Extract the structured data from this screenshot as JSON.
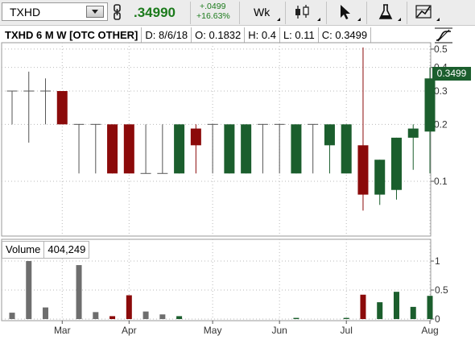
{
  "toolbar": {
    "symbol": "TXHD",
    "last_price": ".34990",
    "change_abs": "+.0499",
    "change_pct": "+16.63%",
    "period": "Wk",
    "icons": [
      "link-icon",
      "candlestick-style-icon",
      "cursor-icon",
      "studies-flask-icon",
      "drawing-tools-icon"
    ]
  },
  "info": {
    "title": "TXHD 6 M W [OTC OTHER]",
    "date": "D: 8/6/18",
    "open": "O: 0.1832",
    "high": "H: 0.4",
    "low": "L: 0.11",
    "close": "C: 0.3499"
  },
  "price_badge": "0.3499",
  "volume": {
    "label": "Volume",
    "value": "404,249"
  },
  "colors": {
    "up": "#1b5e2d",
    "down": "#8b0a0a",
    "neutral": "#555555",
    "volume_neutral": "#6e6e6e",
    "grid": "#b9b9b9",
    "price_green": "#1b7a1b"
  },
  "chart_data": {
    "type": "candlestick",
    "scale": "log",
    "price_axis": {
      "ticks": [
        "0.5",
        "0.4",
        "0.3",
        "0.2",
        "0.1"
      ],
      "tick_values": [
        0.5,
        0.4,
        0.3,
        0.2,
        0.1
      ]
    },
    "volume_axis": {
      "ticks": [
        "1",
        "0.5",
        "0"
      ],
      "tick_values": [
        1,
        0.5,
        0
      ],
      "unit": "M"
    },
    "month_labels": [
      "Mar",
      "Apr",
      "May",
      "Jun",
      "Jul",
      "Aug"
    ],
    "month_label_weeks": [
      3,
      7,
      12,
      16,
      20,
      25
    ],
    "candles": [
      {
        "o": 0.3,
        "h": 0.3,
        "l": 0.2,
        "c": 0.3,
        "v": 0.11
      },
      {
        "o": 0.3,
        "h": 0.38,
        "l": 0.16,
        "c": 0.3,
        "v": 1.0
      },
      {
        "o": 0.3,
        "h": 0.35,
        "l": 0.2,
        "c": 0.3,
        "v": 0.2
      },
      {
        "o": 0.3,
        "h": 0.3,
        "l": 0.2,
        "c": 0.2,
        "v": 0.0
      },
      {
        "o": 0.2,
        "h": 0.2,
        "l": 0.11,
        "c": 0.2,
        "v": 0.93
      },
      {
        "o": 0.2,
        "h": 0.2,
        "l": 0.11,
        "c": 0.2,
        "v": 0.12
      },
      {
        "o": 0.2,
        "h": 0.2,
        "l": 0.11,
        "c": 0.11,
        "v": 0.05
      },
      {
        "o": 0.2,
        "h": 0.2,
        "l": 0.11,
        "c": 0.11,
        "v": 0.41
      },
      {
        "o": 0.11,
        "h": 0.2,
        "l": 0.11,
        "c": 0.11,
        "v": 0.13
      },
      {
        "o": 0.11,
        "h": 0.2,
        "l": 0.11,
        "c": 0.11,
        "v": 0.08
      },
      {
        "o": 0.11,
        "h": 0.2,
        "l": 0.11,
        "c": 0.2,
        "v": 0.05
      },
      {
        "o": 0.19,
        "h": 0.2,
        "l": 0.11,
        "c": 0.155,
        "v": 0.0
      },
      {
        "o": 0.2,
        "h": 0.2,
        "l": 0.11,
        "c": 0.2,
        "v": 0.0
      },
      {
        "o": 0.11,
        "h": 0.2,
        "l": 0.11,
        "c": 0.2,
        "v": 0.0
      },
      {
        "o": 0.11,
        "h": 0.2,
        "l": 0.11,
        "c": 0.2,
        "v": 0.0
      },
      {
        "o": 0.2,
        "h": 0.2,
        "l": 0.11,
        "c": 0.2,
        "v": 0.0
      },
      {
        "o": 0.2,
        "h": 0.2,
        "l": 0.11,
        "c": 0.2,
        "v": 0.0
      },
      {
        "o": 0.11,
        "h": 0.2,
        "l": 0.11,
        "c": 0.2,
        "v": 0.02
      },
      {
        "o": 0.2,
        "h": 0.2,
        "l": 0.11,
        "c": 0.2,
        "v": 0.0
      },
      {
        "o": 0.155,
        "h": 0.2,
        "l": 0.11,
        "c": 0.2,
        "v": 0.0
      },
      {
        "o": 0.11,
        "h": 0.2,
        "l": 0.11,
        "c": 0.2,
        "v": 0.02
      },
      {
        "o": 0.155,
        "h": 0.51,
        "l": 0.07,
        "c": 0.085,
        "v": 0.42
      },
      {
        "o": 0.085,
        "h": 0.13,
        "l": 0.075,
        "c": 0.13,
        "v": 0.29
      },
      {
        "o": 0.09,
        "h": 0.17,
        "l": 0.08,
        "c": 0.17,
        "v": 0.47
      },
      {
        "o": 0.17,
        "h": 0.2,
        "l": 0.115,
        "c": 0.19,
        "v": 0.21
      },
      {
        "o": 0.1832,
        "h": 0.4,
        "l": 0.11,
        "c": 0.3499,
        "v": 0.4
      }
    ]
  }
}
